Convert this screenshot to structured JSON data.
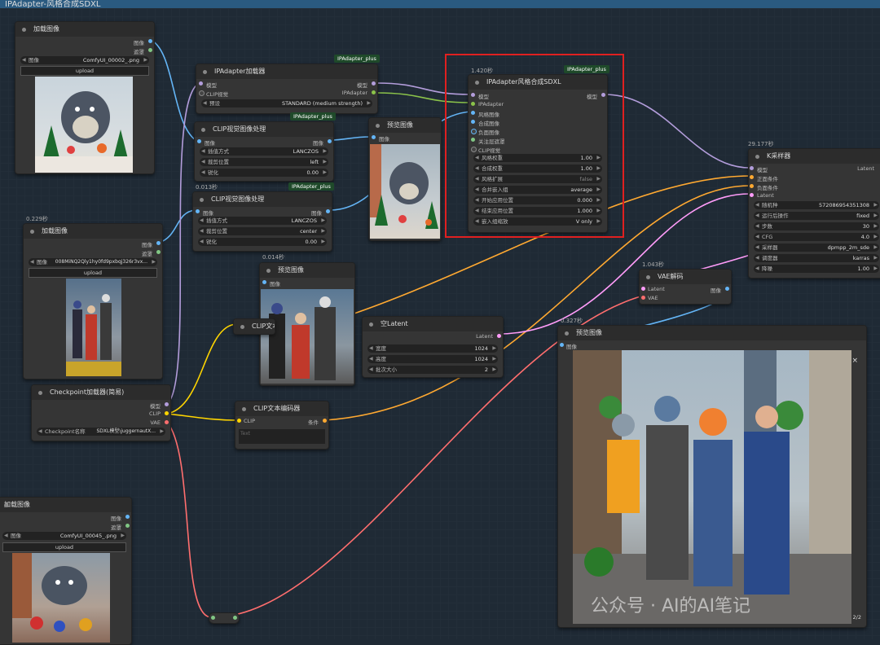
{
  "window": {
    "title": "IPAdapter-风格合成SDXL"
  },
  "colors": {
    "model": "#b39ddb",
    "clip": "#ffd500",
    "vae": "#ff6e6e",
    "image": "#64b5f6",
    "mask": "#81c784",
    "conditioning": "#ffa931",
    "latent": "#ff9cf9",
    "ipadapter": "#8bc34a"
  },
  "load1": {
    "title": "加载图像",
    "out_image": "图像",
    "out_mask": "遮罩",
    "file_label": "图像",
    "file": "ComfyUI_00002_.png",
    "upload": "upload"
  },
  "ipa_loader": {
    "badge": "IPAdapter_plus",
    "title": "IPAdapter加载器",
    "in_model": "模型",
    "in_clip": "CLIP视觉",
    "out_model": "模型",
    "out_ipa": "IPAdapter",
    "preset_label": "预设",
    "preset": "STANDARD (medium strength)"
  },
  "clipvis1": {
    "badge": "IPAdapter_plus",
    "title": "CLIP视觉图像处理",
    "in_image": "图像",
    "out_image": "图像",
    "w1_l": "插值方式",
    "w1_v": "LANCZOS",
    "w2_l": "裁剪位置",
    "w2_v": "left",
    "w3_l": "锐化",
    "w3_v": "0.00"
  },
  "clipvis2": {
    "time": "0.013秒",
    "badge": "IPAdapter_plus",
    "title": "CLIP视觉图像处理",
    "in_image": "图像",
    "out_image": "图像",
    "w1_l": "插值方式",
    "w1_v": "LANCZOS",
    "w2_l": "裁剪位置",
    "w2_v": "center",
    "w3_l": "锐化",
    "w3_v": "0.00"
  },
  "preview1": {
    "title": "预览图像",
    "in_image": "图像"
  },
  "load2": {
    "time": "0.229秒",
    "title": "加载图像",
    "out_image": "图像",
    "out_mask": "遮罩",
    "file_label": "图像",
    "file": "008MiNQ2Qly1hy0fd9pxbqj326r3vx...",
    "upload": "upload"
  },
  "preview2": {
    "time": "0.014秒",
    "title": "预览图像",
    "in_image": "图像"
  },
  "ipa_style": {
    "time": "1.420秒",
    "badge": "IPAdapter_plus",
    "title": "IPAdapter风格合成SDXL",
    "in_model": "模型",
    "in_ipa": "IPAdapter",
    "in_style": "风格图像",
    "in_comp": "合成图像",
    "in_neg": "负面图像",
    "in_mask": "关注层遮罩",
    "in_clipvis": "CLIP视觉",
    "out_model": "模型",
    "w1_l": "风格权重",
    "w1_v": "1.00",
    "w2_l": "合成权重",
    "w2_v": "1.00",
    "toggle_l": "风格扩展",
    "toggle_v": "false",
    "w3_l": "合并嵌入组",
    "w3_v": "average",
    "w4_l": "开始应用位置",
    "w4_v": "0.000",
    "w5_l": "结束应用位置",
    "w5_v": "1.000",
    "w6_l": "嵌入组缩放",
    "w6_v": "V only"
  },
  "ksampler": {
    "time": "29.177秒",
    "title": "K采样器",
    "in_model": "模型",
    "in_pos": "正面条件",
    "in_neg": "负面条件",
    "in_latent": "Latent",
    "out_latent": "Latent",
    "w1_l": "随机种",
    "w1_v": "572086954351308",
    "w2_l": "运行后操作",
    "w2_v": "fixed",
    "w3_l": "步数",
    "w3_v": "30",
    "w4_l": "CFG",
    "w4_v": "4.0",
    "w5_l": "采样器",
    "w5_v": "dpmpp_2m_sde",
    "w6_l": "调度器",
    "w6_v": "karras",
    "w7_l": "降噪",
    "w7_v": "1.00"
  },
  "vae": {
    "time": "1.043秒",
    "title": "VAE解码",
    "in_latent": "Latent",
    "in_vae": "VAE",
    "out_image": "图像"
  },
  "clipenc1": {
    "title": "CLIP文本编码器"
  },
  "empty_latent": {
    "title": "空Latent",
    "out_latent": "Latent",
    "w1_l": "宽度",
    "w1_v": "1024",
    "w2_l": "高度",
    "w2_v": "1024",
    "w3_l": "批次大小",
    "w3_v": "2"
  },
  "preview3": {
    "time": "0.327秒",
    "title": "预览图像",
    "in_image": "图像",
    "close": "×",
    "counter": "2/2"
  },
  "checkpoint": {
    "title": "Checkpoint加载器(简易)",
    "out_model": "模型",
    "out_clip": "CLIP",
    "out_vae": "VAE",
    "w_l": "Checkpoint名称",
    "w_v": "SDXL模型\\juggernautX..."
  },
  "clipenc2": {
    "title": "CLIP文本编码器",
    "in_clip": "CLIP",
    "out_cond": "条件",
    "placeholder": "Text"
  },
  "load3": {
    "title": "加载图像",
    "out_image": "图像",
    "out_mask": "遮罩",
    "file_label": "图像",
    "file": "ComfyUI_00045_.png",
    "upload": "upload"
  },
  "watermark": "公众号 · AI的AI笔记"
}
